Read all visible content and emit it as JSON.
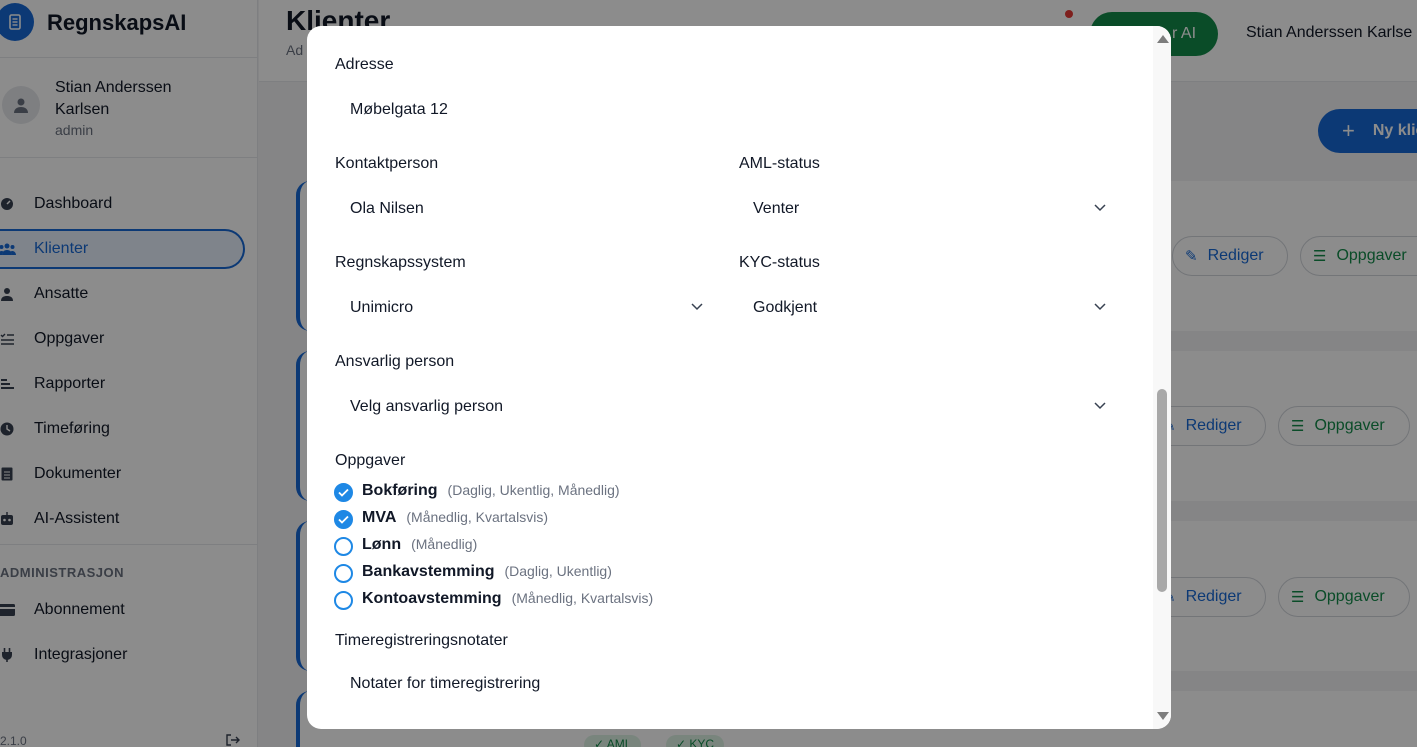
{
  "app": {
    "name": "RegnskapsAI",
    "version": "2.1.0"
  },
  "sidebar": {
    "user": {
      "name": "Stian Anderssen Karlsen",
      "role": "admin"
    },
    "items": [
      {
        "label": "Dashboard",
        "icon": "dashboard-icon"
      },
      {
        "label": "Klienter",
        "icon": "users-icon",
        "active": true
      },
      {
        "label": "Ansatte",
        "icon": "person-icon"
      },
      {
        "label": "Oppgaver",
        "icon": "checklist-icon"
      },
      {
        "label": "Rapporter",
        "icon": "report-icon"
      },
      {
        "label": "Timeføring",
        "icon": "clock-icon"
      },
      {
        "label": "Dokumenter",
        "icon": "document-icon"
      },
      {
        "label": "AI-Assistent",
        "icon": "robot-icon"
      }
    ],
    "admin_section": "ADMINISTRASJON",
    "admin_items": [
      {
        "label": "Abonnement",
        "icon": "card-icon"
      },
      {
        "label": "Integrasjoner",
        "icon": "plug-icon"
      }
    ]
  },
  "header": {
    "title": "Klienter",
    "subtitle": "Ad",
    "ai_button": "r AI",
    "user_name": "Stian Anderssen Karlse",
    "new_client": "Ny klie"
  },
  "cards": {
    "edit_label": "Rediger",
    "tasks_label": "Oppgaver",
    "aml_pill": "✓ AML",
    "kyc_pill": "✓ KYC"
  },
  "modal": {
    "address": {
      "label": "Adresse",
      "value": "Møbelgata 12"
    },
    "contact": {
      "label": "Kontaktperson",
      "value": "Ola Nilsen"
    },
    "aml": {
      "label": "AML-status",
      "value": "Venter"
    },
    "accounting_system": {
      "label": "Regnskapssystem",
      "value": "Unimicro"
    },
    "kyc": {
      "label": "KYC-status",
      "value": "Godkjent"
    },
    "responsible": {
      "label": "Ansvarlig person",
      "value": "Velg ansvarlig person"
    },
    "tasks": {
      "label": "Oppgaver",
      "items": [
        {
          "name": "Bokføring",
          "freq": "(Daglig, Ukentlig, Månedlig)",
          "checked": true
        },
        {
          "name": "MVA",
          "freq": "(Månedlig, Kvartalsvis)",
          "checked": true
        },
        {
          "name": "Lønn",
          "freq": "(Månedlig)",
          "checked": false
        },
        {
          "name": "Bankavstemming",
          "freq": "(Daglig, Ukentlig)",
          "checked": false
        },
        {
          "name": "Kontoavstemming",
          "freq": "(Månedlig, Kvartalsvis)",
          "checked": false
        }
      ]
    },
    "time_notes": {
      "label": "Timeregistreringsnotater",
      "placeholder": "Notater for timeregistrering"
    }
  },
  "colors": {
    "primary": "#1769d6",
    "success": "#138a4a",
    "checkbox": "#1e88e5"
  }
}
